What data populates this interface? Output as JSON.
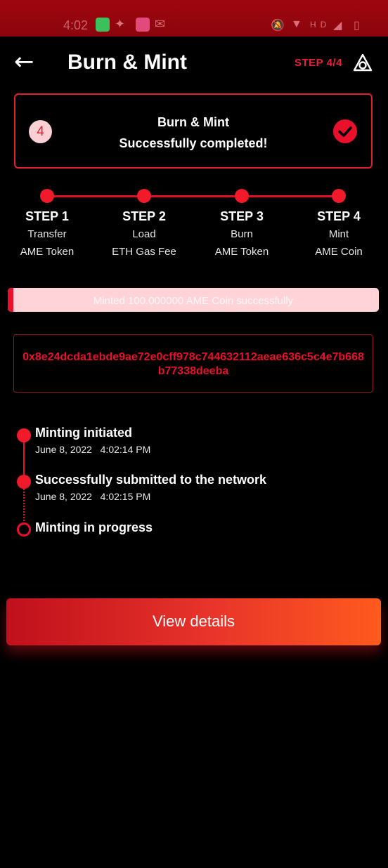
{
  "status_bar": {
    "time": "4:02",
    "icons": [
      "upload-app-icon",
      "feather-app-icon",
      "video-app-icon",
      "gmail-icon",
      "mute-icon",
      "wifi-icon",
      "hd-icon",
      "signal-icon",
      "battery-icon"
    ]
  },
  "header": {
    "title": "Burn & Mint",
    "step_label": "STEP 4/4"
  },
  "status_card": {
    "step_number": "4",
    "line1": "Burn & Mint",
    "line2": "Successfully completed!"
  },
  "steps": [
    {
      "heading": "STEP 1",
      "line1": "Transfer",
      "line2": "AME Token"
    },
    {
      "heading": "STEP 2",
      "line1": "Load",
      "line2": "ETH Gas Fee"
    },
    {
      "heading": "STEP 3",
      "line1": "Burn",
      "line2": "AME Token"
    },
    {
      "heading": "STEP 4",
      "line1": "Mint",
      "line2": "AME Coin"
    }
  ],
  "progress": {
    "text": "Minted 100.000000 AME Coin successfully",
    "fraction": 0.015
  },
  "transaction_hash": "0x8e24dcda1ebde9ae72e0cff978c744632112aeae636c5c4e7b668b77338deeba",
  "timeline": [
    {
      "title": "Minting initiated",
      "date": "June 8, 2022",
      "time": "4:02:14 PM"
    },
    {
      "title": "Successfully submitted to the network",
      "date": "June 8, 2022",
      "time": "4:02:15 PM"
    },
    {
      "title": "Minting in progress"
    }
  ],
  "actions": {
    "view_details": "View details"
  },
  "colors": {
    "accent": "#e8102a",
    "status_bar": "#9a0610",
    "progress_track": "#ffd3d8",
    "button_gradient_start": "#c0101c",
    "button_gradient_end": "#ff5a1e"
  }
}
